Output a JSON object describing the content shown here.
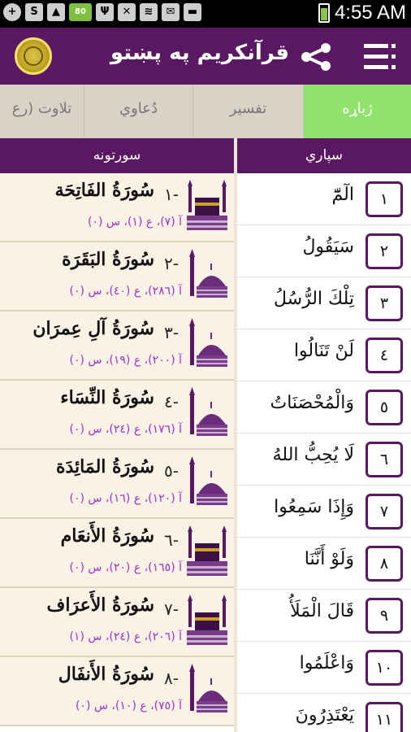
{
  "status_bar": {
    "time": "4:55 AM",
    "icons": [
      "add-icon",
      "skype-icon",
      "image-icon",
      "badge-80-icon",
      "usb-icon",
      "mute-icon",
      "wifi-icon",
      "mail-icon",
      "bag-icon"
    ],
    "badge_text": "80"
  },
  "app": {
    "title": "قرآنکریم په پښتو"
  },
  "tabs": [
    {
      "label": "تلاوت (رع",
      "active": false
    },
    {
      "label": "دُعاوي",
      "active": false
    },
    {
      "label": "تفسير",
      "active": false
    },
    {
      "label": "ژباړه",
      "active": true
    }
  ],
  "columns": {
    "surahs_header": "سورتونه",
    "paras_header": "سپاري"
  },
  "surahs": [
    {
      "num": "١-",
      "name": "سُورَةُ الفَاتِحَة",
      "meta": "آ (٧)، ع (١)، س (٠)",
      "icon": "kaaba-icon"
    },
    {
      "num": "٢-",
      "name": "سُورَةُ البَقَرَة",
      "meta": "آ (٢٨٦)، ع (٤٠)، س (٠)",
      "icon": "mosque-icon"
    },
    {
      "num": "٣-",
      "name": "سُورَةُ آلِ عِمرَان",
      "meta": "آ (٢٠٠)، ع (١٩)، س (٠)",
      "icon": "mosque-icon"
    },
    {
      "num": "٤-",
      "name": "سُورَةُ النِّسَاء",
      "meta": "آ (١٧٦)، ع (٢٤)، س (٠)",
      "icon": "mosque-icon"
    },
    {
      "num": "٥-",
      "name": "سُورَةُ المَائِدَة",
      "meta": "آ (١٢٠)، ع (١٦)، س (٠)",
      "icon": "mosque-icon"
    },
    {
      "num": "٦-",
      "name": "سُورَةُ الأَنعَام",
      "meta": "آ (١٦٥)، ع (٢٠)، س (٠)",
      "icon": "kaaba-icon"
    },
    {
      "num": "٧-",
      "name": "سُورَةُ الأَعرَاف",
      "meta": "آ (٢٠٦)، ع (٢٤)، س (١)",
      "icon": "kaaba-icon"
    },
    {
      "num": "٨-",
      "name": "سُورَةُ الأَنفَال",
      "meta": "آ (٧٥)، ع (١٠)، س (٠)",
      "icon": "mosque-icon"
    }
  ],
  "paras": [
    {
      "num": "١",
      "name": "الٓمّٓ"
    },
    {
      "num": "٢",
      "name": "سَيَقُولُ"
    },
    {
      "num": "٣",
      "name": "تِلْكَ الرُّسُلُ"
    },
    {
      "num": "٤",
      "name": "لَنْ تَنَالُوا"
    },
    {
      "num": "٥",
      "name": "وَالْمُحْصَنَاتُ"
    },
    {
      "num": "٦",
      "name": "لَا يُحِبُّ اللهُ"
    },
    {
      "num": "٧",
      "name": "وَإِذَا سَمِعُوا"
    },
    {
      "num": "٨",
      "name": "وَلَوْ أَنَّنَا"
    },
    {
      "num": "٩",
      "name": "قَالَ الْمَلَأُ"
    },
    {
      "num": "١٠",
      "name": "وَاعْلَمُوا"
    },
    {
      "num": "١١",
      "name": "يَعْتَذِرُونَ"
    }
  ]
}
